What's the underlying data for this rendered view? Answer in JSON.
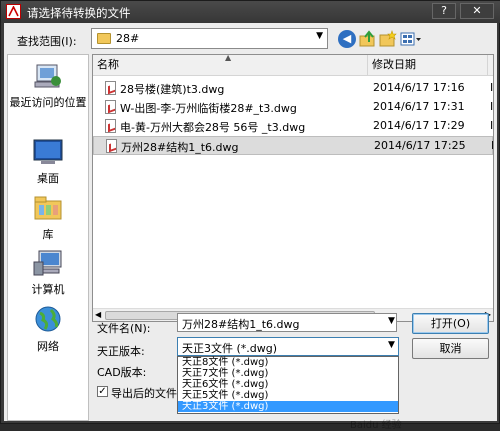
{
  "window": {
    "title": "请选择待转换的文件",
    "help_label": "?",
    "close_label": "✕"
  },
  "toolbar": {
    "lookin_label": "查找范围(I):",
    "lookin_value": "28#",
    "back_glyph": "◀",
    "icons": [
      "back-icon",
      "up-folder-icon",
      "new-folder-icon",
      "views-menu-icon"
    ]
  },
  "places": [
    {
      "label": "最近访问的位置",
      "icon": "recent-places-icon"
    },
    {
      "label": "桌面",
      "icon": "desktop-icon"
    },
    {
      "label": "库",
      "icon": "library-icon"
    },
    {
      "label": "计算机",
      "icon": "computer-icon"
    },
    {
      "label": "网络",
      "icon": "network-icon"
    }
  ],
  "filelist": {
    "headers": {
      "name": "名称",
      "date": "修改日期",
      "extra": "I"
    },
    "rows": [
      {
        "name": "28号楼(建筑)t3.dwg",
        "date": "2014/6/17 17:16",
        "extra": "I",
        "selected": false
      },
      {
        "name": "W-出图-李-万州临街楼28#_t3.dwg",
        "date": "2014/6/17 17:31",
        "extra": "I",
        "selected": false
      },
      {
        "name": "电-黄-万州大都会28号 56号 _t3.dwg",
        "date": "2014/6/17 17:29",
        "extra": "I",
        "selected": false
      },
      {
        "name": "万州28#结构1_t6.dwg",
        "date": "2014/6/17 17:25",
        "extra": "I",
        "selected": true
      }
    ]
  },
  "form": {
    "filename_label": "文件名(N):",
    "filename_value": "万州28#结构1_t6.dwg",
    "version_label": "天正版本:",
    "version_value": "天正3文件 (*.dwg)",
    "cad_label": "CAD版本:",
    "export_label": "导出后的文件自",
    "export_checked": true,
    "check_mark": "✓"
  },
  "dropdown_options": [
    {
      "label": "天正8文件 (*.dwg)",
      "selected": false
    },
    {
      "label": "天正7文件 (*.dwg)",
      "selected": false
    },
    {
      "label": "天正6文件 (*.dwg)",
      "selected": false
    },
    {
      "label": "天正5文件 (*.dwg)",
      "selected": false
    },
    {
      "label": "天正3文件 (*.dwg)",
      "selected": true
    }
  ],
  "buttons": {
    "open": "打开(O)",
    "cancel": "取消"
  },
  "watermark": "Baidu 经验",
  "colors": {
    "title_bar": "#363636",
    "selection": "#3399ff",
    "dialog_bg": "#ececec"
  }
}
